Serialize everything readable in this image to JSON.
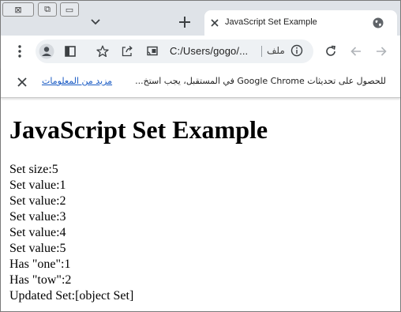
{
  "window": {
    "caption_close": "⊠",
    "caption_maximize": "⧉",
    "caption_minimize": "▭"
  },
  "tab": {
    "title": "JavaScript Set Example",
    "favicon": "globe-icon"
  },
  "toolbar": {
    "url": "C:/Users/gogo/...",
    "file_label": "ملف",
    "icons": [
      "menu-dots-icon",
      "profile-icon",
      "side-panel-icon",
      "bookmark-star-icon",
      "share-icon",
      "cast-icon",
      "info-icon",
      "reload-icon",
      "back-icon",
      "forward-icon"
    ]
  },
  "infobar": {
    "message": "للحصول على تحديثات Google Chrome في المستقبل، يجب استخ...",
    "link": "مزيد من المعلومات"
  },
  "page": {
    "heading": "JavaScript Set Example",
    "lines": [
      "Set size:5",
      "Set value:1",
      "Set value:2",
      "Set value:3",
      "Set value:4",
      "Set value:5",
      "Has \"one\":1",
      "Has \"tow\":2",
      "Updated Set:[object Set]"
    ]
  }
}
